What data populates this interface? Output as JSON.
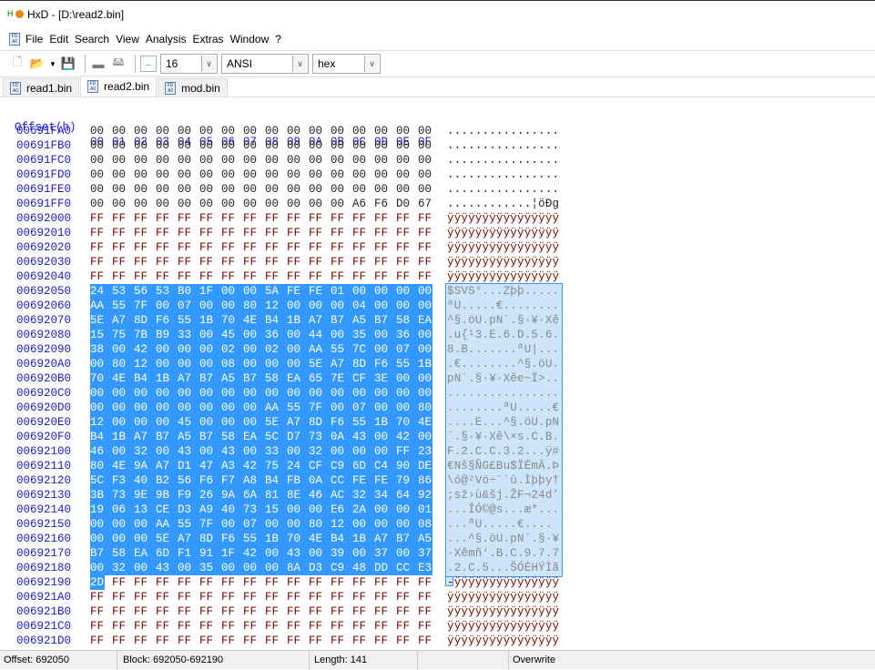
{
  "window": {
    "title": "HxD - [D:\\read2.bin]"
  },
  "menu": [
    "File",
    "Edit",
    "Search",
    "View",
    "Analysis",
    "Extras",
    "Window",
    "?"
  ],
  "toolbar": {
    "bytes_per_row": "16",
    "charset": "ANSI",
    "offset_base": "hex"
  },
  "tabs": [
    {
      "label": "read1.bin",
      "active": false
    },
    {
      "label": "read2.bin",
      "active": true
    },
    {
      "label": "mod.bin",
      "active": false
    }
  ],
  "editor": {
    "header_label": "Offset(h)",
    "columns": [
      "00",
      "01",
      "02",
      "03",
      "04",
      "05",
      "06",
      "07",
      "08",
      "09",
      "0A",
      "0B",
      "0C",
      "0D",
      "0E",
      "0F"
    ],
    "selection": {
      "start": "692050",
      "end": "692190"
    },
    "rows": [
      {
        "offset": "00691FA0",
        "hex": "00 00 00 00 00 00 00 00 00 00 00 00 00 00 00 00",
        "text": "................"
      },
      {
        "offset": "00691FB0",
        "hex": "00 00 00 00 00 00 00 00 00 00 00 00 00 00 00 00",
        "text": "................"
      },
      {
        "offset": "00691FC0",
        "hex": "00 00 00 00 00 00 00 00 00 00 00 00 00 00 00 00",
        "text": "................"
      },
      {
        "offset": "00691FD0",
        "hex": "00 00 00 00 00 00 00 00 00 00 00 00 00 00 00 00",
        "text": "................"
      },
      {
        "offset": "00691FE0",
        "hex": "00 00 00 00 00 00 00 00 00 00 00 00 00 00 00 00",
        "text": "................"
      },
      {
        "offset": "00691FF0",
        "hex": "00 00 00 00 00 00 00 00 00 00 00 00 A6 F6 D0 67",
        "text": "............¦öÐg"
      },
      {
        "offset": "00692000",
        "hex": "FF FF FF FF FF FF FF FF FF FF FF FF FF FF FF FF",
        "text": "ÿÿÿÿÿÿÿÿÿÿÿÿÿÿÿÿ"
      },
      {
        "offset": "00692010",
        "hex": "FF FF FF FF FF FF FF FF FF FF FF FF FF FF FF FF",
        "text": "ÿÿÿÿÿÿÿÿÿÿÿÿÿÿÿÿ"
      },
      {
        "offset": "00692020",
        "hex": "FF FF FF FF FF FF FF FF FF FF FF FF FF FF FF FF",
        "text": "ÿÿÿÿÿÿÿÿÿÿÿÿÿÿÿÿ"
      },
      {
        "offset": "00692030",
        "hex": "FF FF FF FF FF FF FF FF FF FF FF FF FF FF FF FF",
        "text": "ÿÿÿÿÿÿÿÿÿÿÿÿÿÿÿÿ"
      },
      {
        "offset": "00692040",
        "hex": "FF FF FF FF FF FF FF FF FF FF FF FF FF FF FF FF",
        "text": "ÿÿÿÿÿÿÿÿÿÿÿÿÿÿÿÿ"
      },
      {
        "offset": "00692050",
        "hex": "24 53 56 53 B0 1F 00 00 5A FE FE 01 00 00 00 00",
        "text": "$SVS°...Zþþ....."
      },
      {
        "offset": "00692060",
        "hex": "AA 55 7F 00 07 00 00 80 12 00 00 00 04 00 00 00",
        "text": "ªU.....€........"
      },
      {
        "offset": "00692070",
        "hex": "5E A7 8D F6 55 1B 70 4E B4 1B A7 B7 A5 B7 58 EA",
        "text": "^§.öU.pN´.§·¥·Xê"
      },
      {
        "offset": "00692080",
        "hex": "15 75 7B B9 33 00 45 00 36 00 44 00 35 00 36 00",
        "text": ".u{¹3.E.6.D.5.6."
      },
      {
        "offset": "00692090",
        "hex": "38 00 42 00 00 00 02 00 02 00 AA 55 7C 00 07 00",
        "text": "8.B.......ªU|..."
      },
      {
        "offset": "006920A0",
        "hex": "00 80 12 00 00 00 08 00 00 00 5E A7 8D F6 55 1B",
        "text": ".€........^§.öU."
      },
      {
        "offset": "006920B0",
        "hex": "70 4E B4 1B A7 B7 A5 B7 58 EA 65 7E CF 3E 00 00",
        "text": "pN´.§·¥·Xêe~Ï>.."
      },
      {
        "offset": "006920C0",
        "hex": "00 00 00 00 00 00 00 00 00 00 00 00 00 00 00 00",
        "text": "................"
      },
      {
        "offset": "006920D0",
        "hex": "00 00 00 00 00 00 00 00 AA 55 7F 00 07 00 00 80",
        "text": "........ªU.....€"
      },
      {
        "offset": "006920E0",
        "hex": "12 00 00 00 45 00 00 00 5E A7 8D F6 55 1B 70 4E",
        "text": "....E...^§.öU.pN"
      },
      {
        "offset": "006920F0",
        "hex": "B4 1B A7 B7 A5 B7 58 EA 5C D7 73 0A 43 00 42 00",
        "text": "´.§·¥·Xê\\×s.C.B."
      },
      {
        "offset": "00692100",
        "hex": "46 00 32 00 43 00 43 00 33 00 32 00 00 00 FF 23",
        "text": "F.2.C.C.3.2...ÿ#"
      },
      {
        "offset": "00692110",
        "hex": "80 4E 9A A7 D1 47 A3 42 75 24 CF C9 6D C4 90 DE",
        "text": "€Nš§ÑG£Bu$ÏÉmÄ.Þ"
      },
      {
        "offset": "00692120",
        "hex": "5C F3 40 B2 56 F6 F7 A8 B4 FB 0A CC FE FE 79 86",
        "text": "\\ó@²Vö÷¨´û.Ìþþy†"
      },
      {
        "offset": "00692130",
        "hex": "3B 73 9E 9B F9 26 9A 6A 81 8E 46 AC 32 34 64 92",
        "text": ";sž›ù&šj.ŽF¬24d’"
      },
      {
        "offset": "00692140",
        "hex": "19 06 13 CE D3 A9 40 73 15 00 00 E6 2A 00 00 01",
        "text": "...ÎÓ©@s...æ*..."
      },
      {
        "offset": "00692150",
        "hex": "00 00 00 AA 55 7F 00 07 00 00 80 12 00 00 00 08",
        "text": "...ªU.....€...."
      },
      {
        "offset": "00692160",
        "hex": "00 00 00 5E A7 8D F6 55 1B 70 4E B4 1B A7 B7 A5",
        "text": "...^§.öU.pN´.§·¥"
      },
      {
        "offset": "00692170",
        "hex": "B7 58 EA 6D F1 91 1F 42 00 43 00 39 00 37 00 37",
        "text": "·Xêmñ‘.B.C.9.7.7"
      },
      {
        "offset": "00692180",
        "hex": "00 32 00 43 00 35 00 00 00 8A D3 C9 48 DD CC E3",
        "text": ".2.C.5...ŠÓÉHÝÌã"
      },
      {
        "offset": "00692190",
        "hex": "2D FF FF FF FF FF FF FF FF FF FF FF FF FF FF FF",
        "text": "-ÿÿÿÿÿÿÿÿÿÿÿÿÿÿÿ"
      },
      {
        "offset": "006921A0",
        "hex": "FF FF FF FF FF FF FF FF FF FF FF FF FF FF FF FF",
        "text": "ÿÿÿÿÿÿÿÿÿÿÿÿÿÿÿÿ"
      },
      {
        "offset": "006921B0",
        "hex": "FF FF FF FF FF FF FF FF FF FF FF FF FF FF FF FF",
        "text": "ÿÿÿÿÿÿÿÿÿÿÿÿÿÿÿÿ"
      },
      {
        "offset": "006921C0",
        "hex": "FF FF FF FF FF FF FF FF FF FF FF FF FF FF FF FF",
        "text": "ÿÿÿÿÿÿÿÿÿÿÿÿÿÿÿÿ"
      },
      {
        "offset": "006921D0",
        "hex": "FF FF FF FF FF FF FF FF FF FF FF FF FF FF FF FF",
        "text": "ÿÿÿÿÿÿÿÿÿÿÿÿÿÿÿÿ"
      }
    ]
  },
  "status": {
    "offset": "Offset: 692050",
    "block": "Block: 692050-692190",
    "length": "Length: 141",
    "empty": "",
    "mode": "Overwrite"
  }
}
